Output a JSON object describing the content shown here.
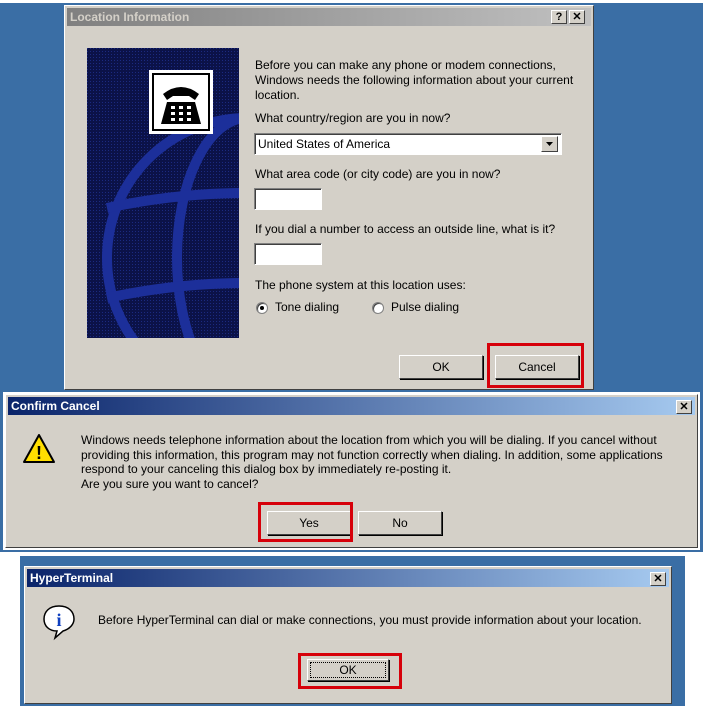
{
  "location_dialog": {
    "title": "Location Information",
    "help_button": "?",
    "close_button": "✕",
    "intro": "Before you can make any phone or modem connections, Windows needs the following information about your current location.",
    "country_label": "What country/region are you in now?",
    "country_value": "United States of America",
    "area_code_label": "What area code (or city code) are you in now?",
    "area_code_value": "",
    "outside_line_label": "If you dial a number to access an outside line, what is it?",
    "outside_line_value": "",
    "phone_system_label": "The phone system at this location uses:",
    "tone_label": "Tone dialing",
    "pulse_label": "Pulse dialing",
    "selected_dialing": "tone",
    "ok_label": "OK",
    "cancel_label": "Cancel"
  },
  "confirm_dialog": {
    "title": "Confirm Cancel",
    "close_button": "✕",
    "message_lines": [
      "Windows needs telephone information about the location from which you will be dialing. If you cancel without",
      "providing this information, this program may not function correctly when dialing. In addition, some applications",
      "respond to your canceling this dialog box by immediately re-posting it.",
      "Are you sure you want to cancel?"
    ],
    "warning_glyph": "!",
    "yes_label": "Yes",
    "no_label": "No"
  },
  "hyper_dialog": {
    "title": "HyperTerminal",
    "close_button": "✕",
    "info_glyph": "i",
    "message": "Before HyperTerminal can dial or make connections, you must provide information about your location.",
    "ok_label": "OK"
  },
  "colors": {
    "desktop": "#3a6ea5",
    "dialog_face": "#d4d0c8",
    "highlight_box": "#d6000a",
    "active_title": "#0a246a"
  }
}
